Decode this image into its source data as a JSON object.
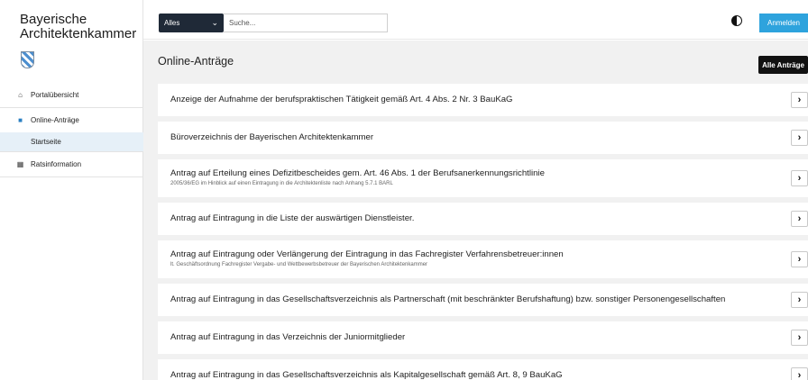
{
  "sidebar": {
    "org_name": "Bayerische Architektenkammer",
    "crest_icon": "bavarian-crest-icon",
    "items": [
      {
        "label": "Portalübersicht",
        "icon": "home-icon"
      },
      {
        "label": "Online-Anträge",
        "icon": "document-icon"
      },
      {
        "label": "Startseite"
      },
      {
        "label": "Ratsinformation",
        "icon": "building-icon"
      }
    ]
  },
  "topbar": {
    "category": "Alles",
    "search_placeholder": "Suche...",
    "contrast_icon": "contrast-icon",
    "login_label": "Anmelden"
  },
  "main": {
    "title": "Online-Anträge",
    "all_button": "Alle Anträge",
    "cards": [
      {
        "title": "Anzeige der Aufnahme der berufspraktischen Tätigkeit gemäß Art. 4 Abs. 2 Nr. 3 BauKaG",
        "subtitle": ""
      },
      {
        "title": "Büroverzeichnis der Bayerischen Architektenkammer",
        "subtitle": ""
      },
      {
        "title": "Antrag auf Erteilung eines Defizitbescheides gem. Art. 46 Abs. 1 der Berufsanerkennungsrichtlinie",
        "subtitle": "2005/36/EG im Hinblick auf einen Eintragung in die Architektenliste nach Anhang 5.7.1 BARL"
      },
      {
        "title": "Antrag auf Eintragung in die Liste der auswärtigen Dienstleister.",
        "subtitle": ""
      },
      {
        "title": "Antrag auf Eintragung oder Verlängerung der Eintragung in das Fachregister Verfahrensbetreuer:innen",
        "subtitle": "lt. Geschäftsordnung Fachregister Vergabe- und Wettbewerbsbetreuer der Bayerischen Architektenkammer"
      },
      {
        "title": "Antrag auf Eintragung in das Gesellschaftsverzeichnis als Partnerschaft (mit beschränkter Berufshaftung) bzw. sonstiger Personengesellschaften",
        "subtitle": ""
      },
      {
        "title": "Antrag auf Eintragung in das Verzeichnis der Juniormitglieder",
        "subtitle": ""
      },
      {
        "title": "Antrag auf Eintragung in das Gesellschaftsverzeichnis als Kapitalgesellschaft gemäß Art. 8, 9 BauKaG",
        "subtitle": ""
      }
    ],
    "arrow_icon": "chevron-right-icon"
  }
}
